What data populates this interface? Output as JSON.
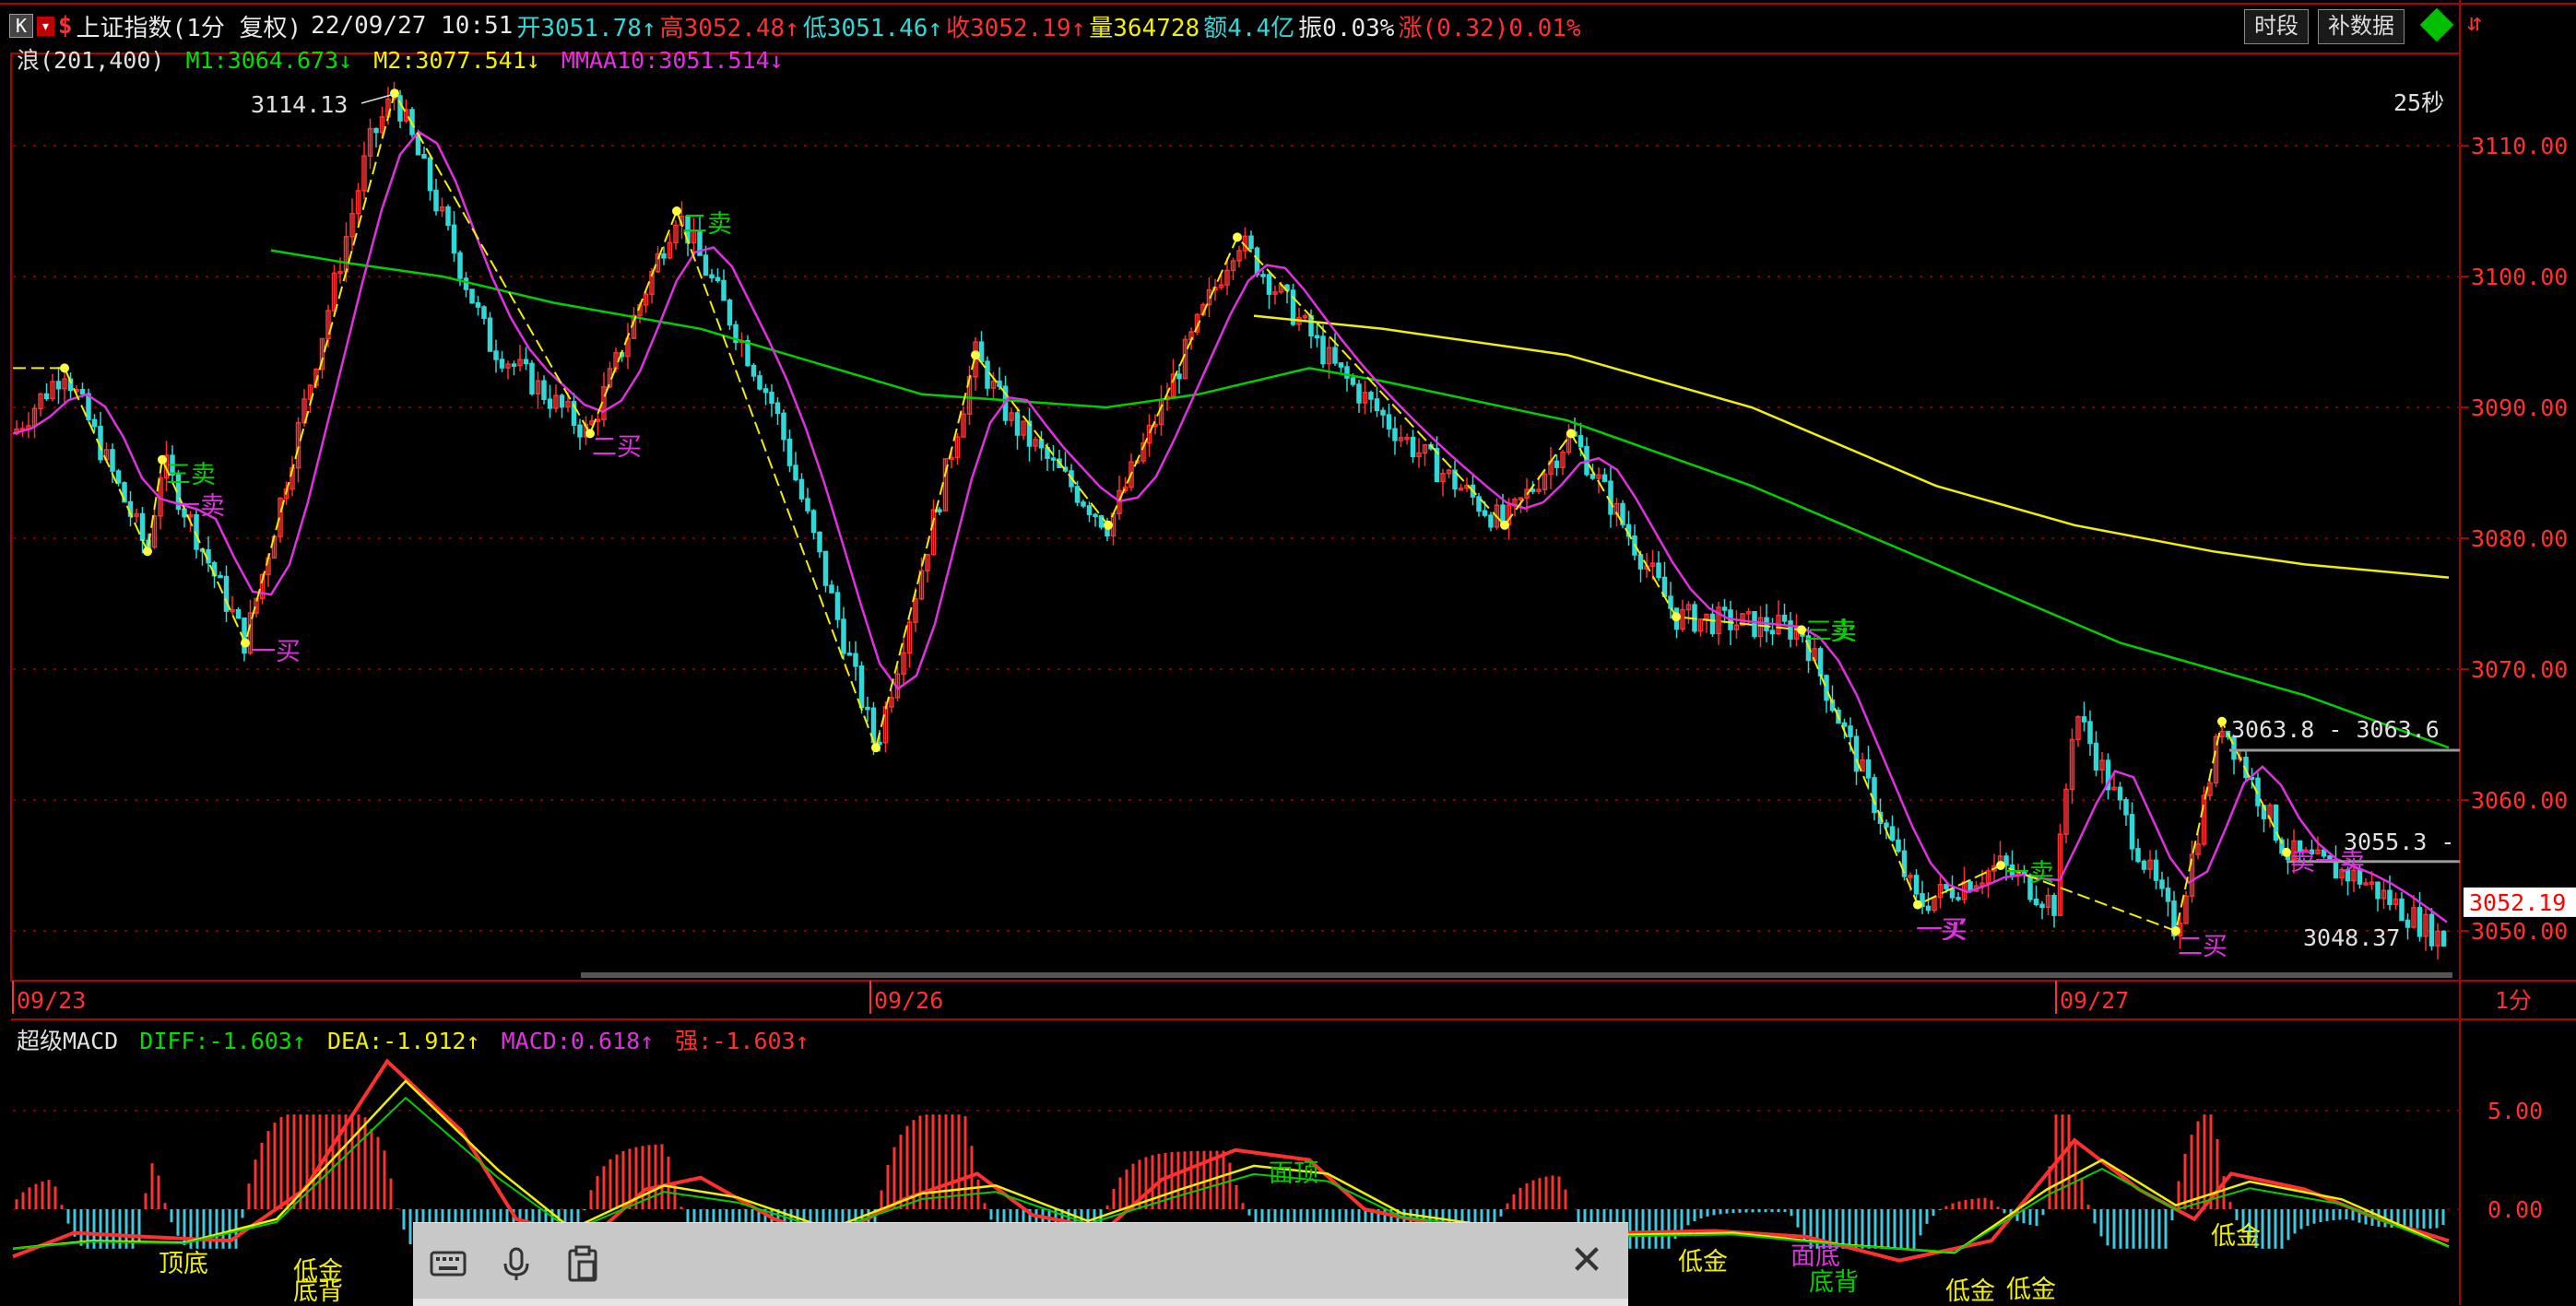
{
  "header": {
    "k_label": "K",
    "menu_label": "▾",
    "dollar": "$",
    "name": "上证指数(1分 复权)",
    "datetime": "22/09/27 10:51",
    "open": "开3051.78↑",
    "high": "高3052.48↑",
    "low": "低3051.46↑",
    "close": "收3052.19↑",
    "volume": "量364728",
    "amount": "额4.4亿",
    "amplitude": "振0.03%",
    "change": "涨(0.32)0.01%",
    "btn_period": "时段",
    "btn_supplement": "补数据"
  },
  "indicator_main": {
    "name": "浪(201,400)",
    "m1": "M1:3064.673↓",
    "m2": "M2:3077.541↓",
    "mmaa": "MMAA10:3051.514↓"
  },
  "indicator_macd": {
    "name": "超级MACD",
    "diff": "DIFF:-1.603↑",
    "dea": "DEA:-1.912↑",
    "macd": "MACD:0.618↑",
    "strong": "强:-1.603↑"
  },
  "timer": "25秒",
  "price_axis": [
    "3110.00",
    "3100.00",
    "3090.00",
    "3080.00",
    "3070.00",
    "3060.00",
    "3050.00"
  ],
  "current_price": "3052.19",
  "macd_axis": [
    "5.00",
    "0.00"
  ],
  "date_axis": [
    "09/23",
    "09/26",
    "09/27"
  ],
  "period_label": "1分",
  "annotations": {
    "peak": "3114.13",
    "range_high": "3063.8 - 3063.6",
    "mid_level": "3055.3 -",
    "low_value": "3048.37"
  },
  "signals": [
    "三卖",
    "一买",
    "一卖",
    "二卖",
    "二买",
    "一买",
    "一卖",
    "三卖",
    "三卖",
    "一买",
    "二买",
    "卖一卖"
  ],
  "macd_signals": [
    "顶底",
    "低金",
    "底背",
    "面顶",
    "低金",
    "面底",
    "底背",
    "低金",
    "低金",
    "低金"
  ],
  "colors": {
    "bg": "#000000",
    "border": "#b00000",
    "up": "#ff3030",
    "down": "#30d8d8",
    "yellow": "#f0f000",
    "green": "#00d000",
    "magenta": "#e030e0",
    "dot": "#ffff40"
  },
  "toolbar_icons": [
    "keyboard-icon",
    "microphone-icon",
    "clipboard-icon"
  ]
}
